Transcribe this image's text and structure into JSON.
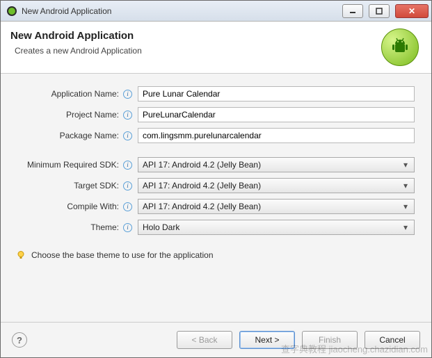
{
  "window": {
    "title": "New Android Application"
  },
  "header": {
    "title": "New Android Application",
    "subtitle": "Creates a new Android Application"
  },
  "form": {
    "applicationName": {
      "label": "Application Name:",
      "value": "Pure Lunar Calendar"
    },
    "projectName": {
      "label": "Project Name:",
      "value": "PureLunarCalendar"
    },
    "packageName": {
      "label": "Package Name:",
      "value": "com.lingsmm.purelunarcalendar"
    },
    "minSdk": {
      "label": "Minimum Required SDK:",
      "value": "API 17: Android 4.2 (Jelly Bean)"
    },
    "targetSdk": {
      "label": "Target SDK:",
      "value": "API 17: Android 4.2 (Jelly Bean)"
    },
    "compileWith": {
      "label": "Compile With:",
      "value": "API 17: Android 4.2 (Jelly Bean)"
    },
    "theme": {
      "label": "Theme:",
      "value": "Holo Dark"
    }
  },
  "tip": "Choose the base theme to use for the application",
  "buttons": {
    "back": "< Back",
    "next": "Next >",
    "finish": "Finish",
    "cancel": "Cancel"
  },
  "icons": {
    "info": "i",
    "help": "?"
  },
  "watermark": "查字典教程 jiaocheng.chazidian.com"
}
